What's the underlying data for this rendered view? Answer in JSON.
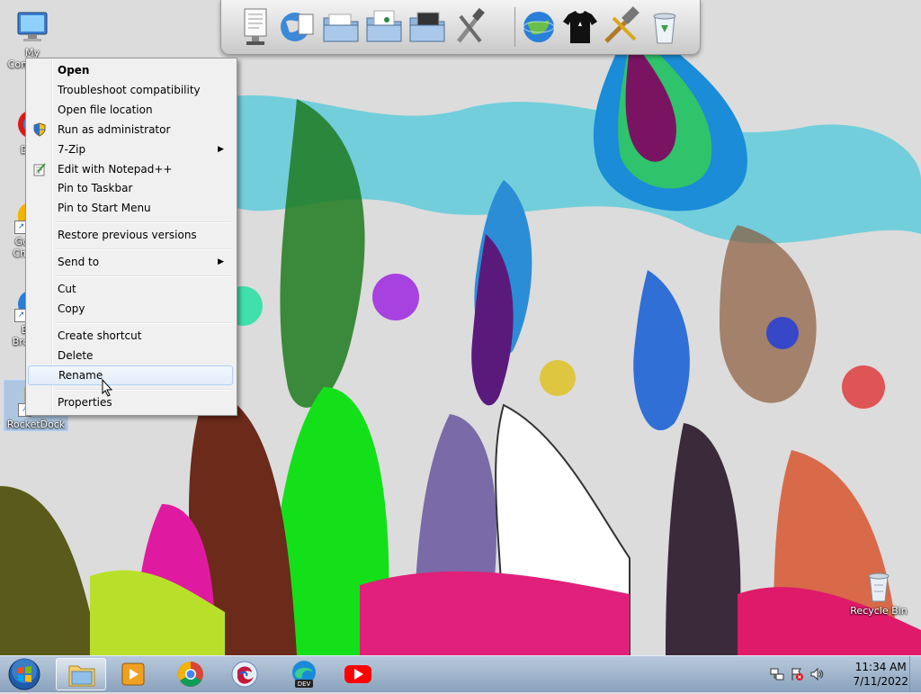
{
  "desktop": {
    "icons": [
      {
        "label": "My Computer",
        "selected": false
      },
      {
        "label": "Data",
        "selected": false
      },
      {
        "label": "Google Chrome",
        "selected": false
      },
      {
        "label": "Bing Browser",
        "selected": false
      },
      {
        "label": "RocketDock",
        "selected": true
      }
    ],
    "recycle_bin_label": "Recycle Bin"
  },
  "dock": {
    "items": [
      "document-monitor-icon",
      "globe-document-icon",
      "folder-icon",
      "folder-music-icon",
      "folder-pictures-icon",
      "tools-icon",
      "globe-network-icon",
      "tshirt-icon",
      "hammer-wrench-icon",
      "recycle-bin-icon"
    ]
  },
  "context_menu": {
    "items": [
      {
        "label": "Open",
        "bold": true
      },
      {
        "label": "Troubleshoot compatibility"
      },
      {
        "label": "Open file location"
      },
      {
        "label": "Run as administrator",
        "icon": "uac-shield-icon"
      },
      {
        "label": "7-Zip",
        "submenu": true
      },
      {
        "label": "Edit with Notepad++",
        "icon": "notepad-plus-icon"
      },
      {
        "label": "Pin to Taskbar"
      },
      {
        "label": "Pin to Start Menu"
      },
      {
        "label": "Restore previous versions"
      },
      {
        "label": "Send to",
        "submenu": true
      },
      {
        "label": "Cut"
      },
      {
        "label": "Copy"
      },
      {
        "label": "Create shortcut"
      },
      {
        "label": "Delete"
      },
      {
        "label": "Rename",
        "highlighted": true
      },
      {
        "label": "Properties"
      }
    ],
    "submenu_arrow": "▶"
  },
  "taskbar": {
    "pinned": [
      "file-explorer-icon",
      "media-player-icon",
      "chrome-icon",
      "browser-icon",
      "edge-dev-icon",
      "youtube-icon"
    ],
    "tray_icons": [
      "network-icon",
      "flag-error-icon",
      "volume-icon"
    ],
    "clock": {
      "time": "11:34 AM",
      "date": "7/11/2022"
    }
  },
  "colors": {
    "taskbar": "#8aa2bd",
    "menu_bg": "#f0f0f0",
    "menu_highlight": "#e1ecfa"
  }
}
